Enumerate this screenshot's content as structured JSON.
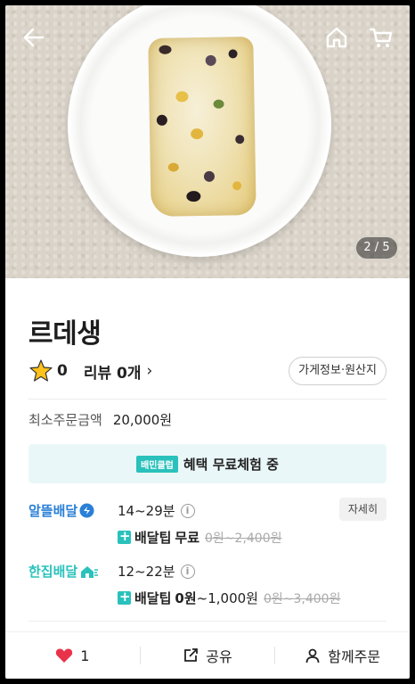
{
  "hero": {
    "image_counter": "2 / 5"
  },
  "nav": {
    "back_icon": "arrow-left-icon",
    "home_icon": "home-icon",
    "cart_icon": "cart-icon"
  },
  "store": {
    "name": "르데생",
    "rating": "0",
    "reviews_label": "리뷰 0개",
    "info_button": "가게정보·원산지"
  },
  "min_order": {
    "label": "최소주문금액",
    "value": "20,000원"
  },
  "club_banner": {
    "badge": "배민클럽",
    "text": "혜택 무료체험 중"
  },
  "deliveries": [
    {
      "name": "알뜰배달",
      "color": "#2a7fd6",
      "time": "14~29분",
      "tip_label": "배달팁",
      "tip_value": "무료",
      "tip_rest": "",
      "tip_strike": "0원~2,400원",
      "detail_button": "자세히"
    },
    {
      "name": "한집배달",
      "color": "#2ac1bc",
      "time": "12~22분",
      "tip_label": "배달팁",
      "tip_value": "0원",
      "tip_rest": "~1,000원",
      "tip_strike": "0원~3,400원"
    }
  ],
  "bottom_bar": {
    "like_count": "1",
    "share_label": "공유",
    "group_order_label": "함께주문"
  },
  "colors": {
    "accent_mint": "#2ac1bc",
    "like_red": "#e8334a",
    "star_yellow": "#ffc21a"
  }
}
